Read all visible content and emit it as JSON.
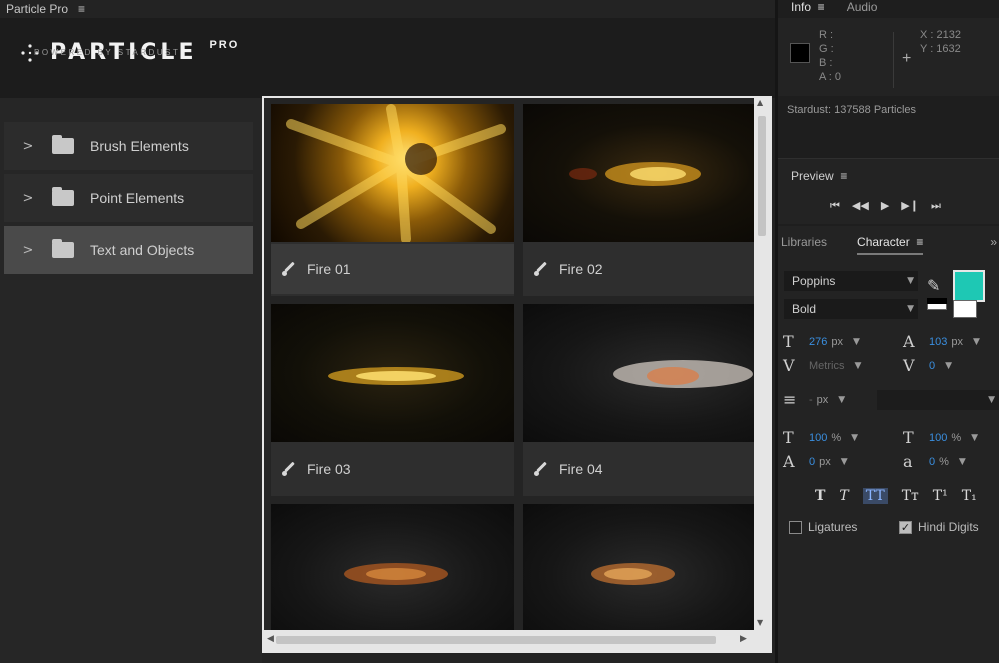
{
  "app": {
    "tab_title": "Particle Pro",
    "tab_menu_icon": "hamburger-icon"
  },
  "logo": {
    "word": "PARTICLE",
    "sup": "PRO",
    "tagline": "POWERED BY STARDUST"
  },
  "sidebar": {
    "items": [
      {
        "label": "Brush Elements",
        "active": false
      },
      {
        "label": "Point Elements",
        "active": false
      },
      {
        "label": "Text and Objects",
        "active": true
      }
    ]
  },
  "grid": {
    "tiles": [
      {
        "label": "Fire 01",
        "selected": true
      },
      {
        "label": "Fire 02",
        "selected": false
      },
      {
        "label": "Fire 03",
        "selected": false
      },
      {
        "label": "Fire 04",
        "selected": false
      },
      {
        "label": "",
        "selected": false
      },
      {
        "label": "",
        "selected": false
      }
    ]
  },
  "info": {
    "tabs": [
      "Info",
      "Audio"
    ],
    "rgba": [
      "R :",
      "G :",
      "B :",
      "A : 0"
    ],
    "x": "X : 2132",
    "y": "Y : 1632",
    "stardust": "Stardust: 137588 Particles"
  },
  "preview": {
    "title": "Preview",
    "controls": [
      "⏮",
      "◀◀",
      "▶",
      "▶❙",
      "⏭"
    ]
  },
  "character": {
    "tabs": [
      "Libraries",
      "Character"
    ],
    "close": "»",
    "font": "Poppins",
    "weight": "Bold",
    "font_size": "276",
    "font_size_unit": "px",
    "leading": "103",
    "leading_unit": "px",
    "kerning": "Metrics",
    "tracking": "0",
    "stroke_width": "-",
    "stroke_unit": "px",
    "vert_scale": "100",
    "vert_scale_unit": "%",
    "horiz_scale": "100",
    "horiz_scale_unit": "%",
    "baseline": "0",
    "baseline_unit": "px",
    "tsume": "0",
    "tsume_unit": "%",
    "text_styles": [
      "T",
      "T",
      "TT",
      "Tт",
      "T¹",
      "T₁"
    ],
    "ligatures": "Ligatures",
    "hindi_digits": "Hindi Digits",
    "fill_color": "#1ec8b4"
  }
}
